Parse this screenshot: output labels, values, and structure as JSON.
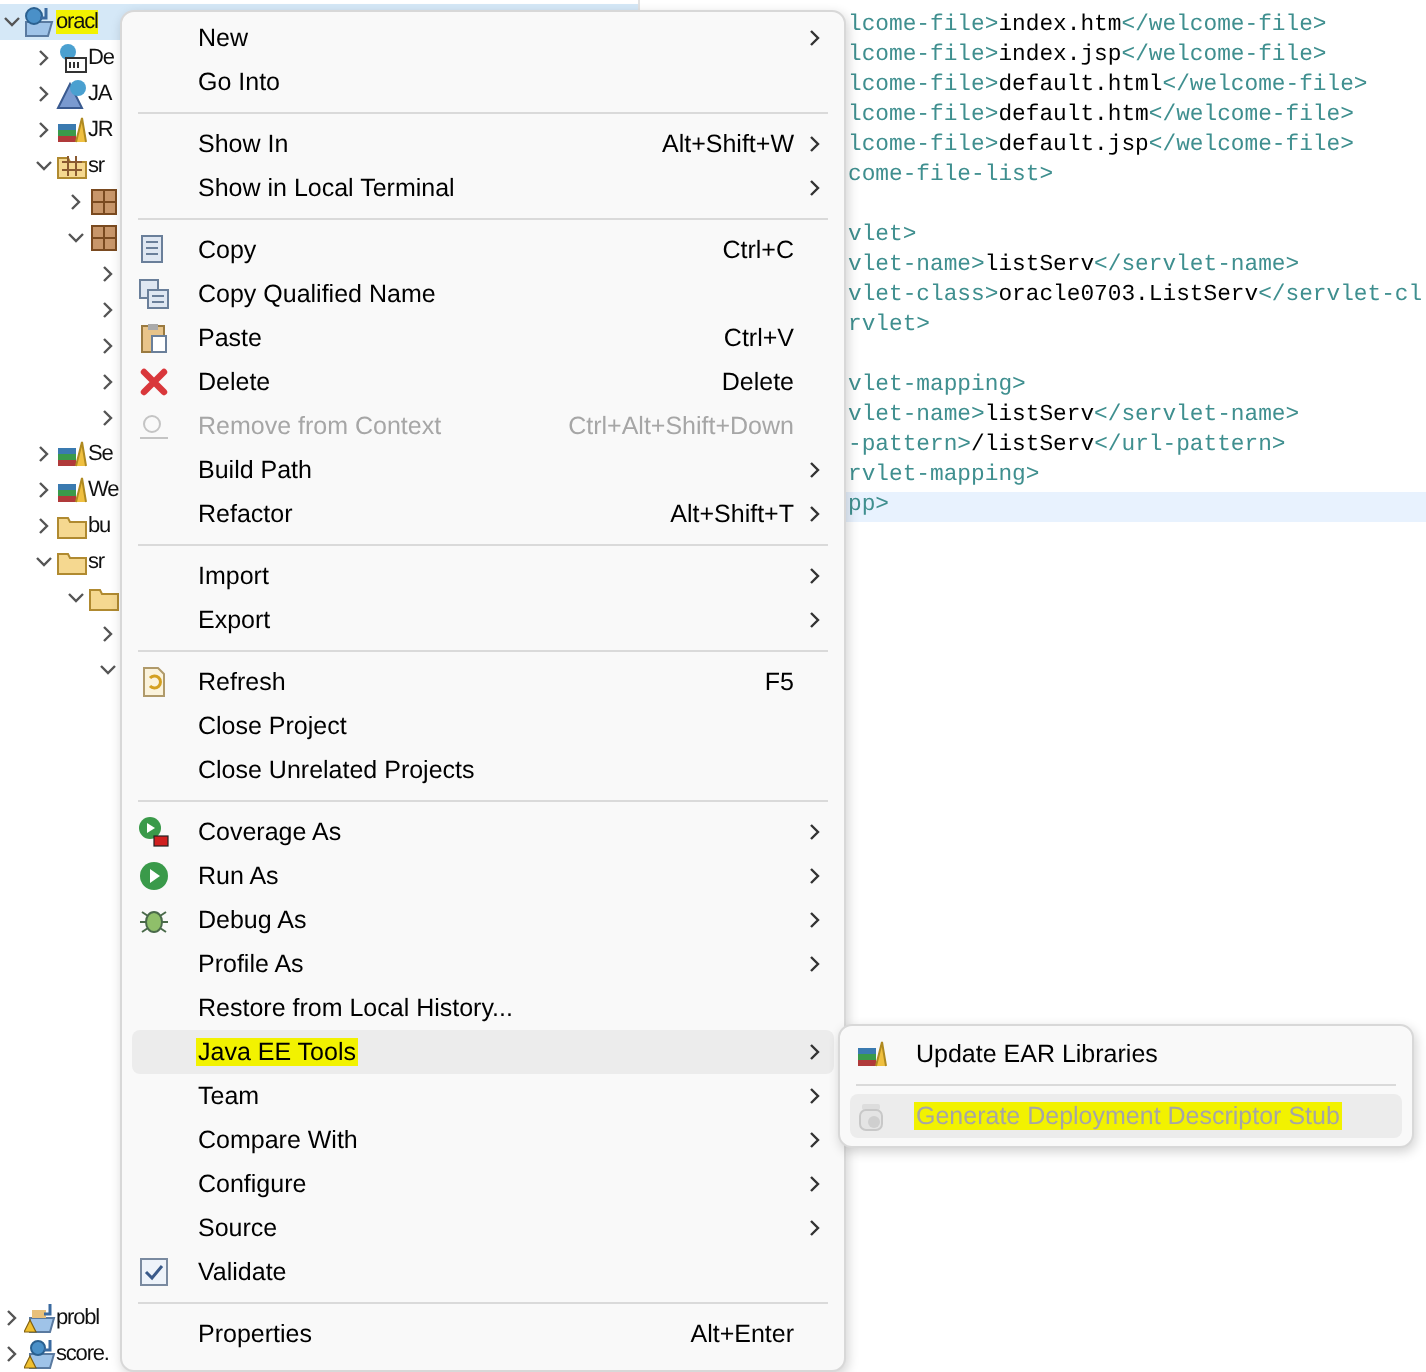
{
  "tree": [
    {
      "label": "oracl",
      "kind": "project",
      "expanded": true,
      "selected": true,
      "marked": true,
      "children": [
        {
          "label": "De",
          "kind": "descriptor",
          "expanded": false,
          "selected": false,
          "marked": false
        },
        {
          "label": "JA",
          "kind": "jax",
          "expanded": false,
          "selected": false,
          "marked": false
        },
        {
          "label": "JR",
          "kind": "library",
          "expanded": false,
          "selected": false,
          "marked": false
        },
        {
          "label": "sr",
          "kind": "package-folder",
          "expanded": true,
          "selected": false,
          "marked": false,
          "children": [
            {
              "kind": "package",
              "expanded": false,
              "selected": false
            },
            {
              "kind": "package",
              "expanded": true,
              "selected": false,
              "children": [
                {
                  "expanded": false,
                  "selected": false
                },
                {
                  "expanded": false,
                  "selected": false
                },
                {
                  "expanded": false,
                  "selected": false
                },
                {
                  "expanded": false,
                  "selected": false
                },
                {
                  "expanded": false,
                  "selected": false
                }
              ]
            }
          ]
        },
        {
          "label": "Se",
          "kind": "library",
          "expanded": false,
          "selected": false,
          "marked": false
        },
        {
          "label": "We",
          "kind": "library",
          "expanded": false,
          "selected": false,
          "marked": false
        },
        {
          "label": "bu",
          "kind": "folder",
          "expanded": false,
          "selected": false,
          "marked": false
        },
        {
          "label": "sr",
          "kind": "folder",
          "expanded": true,
          "selected": false,
          "marked": false,
          "children": [
            {
              "kind": "folder",
              "expanded": true,
              "selected": false,
              "children": [
                {
                  "expanded": false,
                  "selected": false
                },
                {
                  "expanded": true,
                  "selected": false
                }
              ]
            }
          ]
        }
      ]
    }
  ],
  "bottom_tree": [
    {
      "label": "probl",
      "kind": "warning-project",
      "expanded": false,
      "selected": false,
      "marked": false
    },
    {
      "label": "score.",
      "kind": "warning-web-project",
      "expanded": false,
      "selected": false,
      "marked": false
    }
  ],
  "editor_lines": [
    {
      "kind": "code",
      "current": false,
      "segments": [
        {
          "kind": "tag",
          "text": "lcome-file>"
        },
        {
          "kind": "text",
          "text": "index.htm"
        },
        {
          "kind": "tag",
          "text": "</welcome-file>"
        }
      ]
    },
    {
      "kind": "code",
      "current": false,
      "segments": [
        {
          "kind": "tag",
          "text": "lcome-file>"
        },
        {
          "kind": "text",
          "text": "index.jsp"
        },
        {
          "kind": "tag",
          "text": "</welcome-file>"
        }
      ]
    },
    {
      "kind": "code",
      "current": false,
      "segments": [
        {
          "kind": "tag",
          "text": "lcome-file>"
        },
        {
          "kind": "text",
          "text": "default.html"
        },
        {
          "kind": "tag",
          "text": "</welcome-file>"
        }
      ]
    },
    {
      "kind": "code",
      "current": false,
      "segments": [
        {
          "kind": "tag",
          "text": "lcome-file>"
        },
        {
          "kind": "text",
          "text": "default.htm"
        },
        {
          "kind": "tag",
          "text": "</welcome-file>"
        }
      ]
    },
    {
      "kind": "code",
      "current": false,
      "segments": [
        {
          "kind": "tag",
          "text": "lcome-file>"
        },
        {
          "kind": "text",
          "text": "default.jsp"
        },
        {
          "kind": "tag",
          "text": "</welcome-file>"
        }
      ]
    },
    {
      "kind": "code",
      "current": false,
      "segments": [
        {
          "kind": "tag",
          "text": "come-file-list>"
        }
      ]
    },
    {
      "kind": "blank",
      "current": false
    },
    {
      "kind": "code",
      "current": false,
      "segments": [
        {
          "kind": "tag",
          "text": "vlet>"
        }
      ]
    },
    {
      "kind": "code",
      "current": false,
      "segments": [
        {
          "kind": "tag",
          "text": "vlet-name>"
        },
        {
          "kind": "text",
          "text": "listServ"
        },
        {
          "kind": "tag",
          "text": "</servlet-name>"
        }
      ]
    },
    {
      "kind": "code",
      "current": false,
      "segments": [
        {
          "kind": "tag",
          "text": "vlet-class>"
        },
        {
          "kind": "text",
          "text": "oracle0703.ListServ"
        },
        {
          "kind": "tag",
          "text": "</servlet-cl"
        }
      ]
    },
    {
      "kind": "code",
      "current": false,
      "segments": [
        {
          "kind": "tag",
          "text": "rvlet>"
        }
      ]
    },
    {
      "kind": "blank",
      "current": false
    },
    {
      "kind": "code",
      "current": false,
      "segments": [
        {
          "kind": "tag",
          "text": "vlet-mapping>"
        }
      ]
    },
    {
      "kind": "code",
      "current": false,
      "segments": [
        {
          "kind": "tag",
          "text": "vlet-name>"
        },
        {
          "kind": "text",
          "text": "listServ"
        },
        {
          "kind": "tag",
          "text": "</servlet-name>"
        }
      ]
    },
    {
      "kind": "code",
      "current": false,
      "segments": [
        {
          "kind": "tag",
          "text": "-pattern>"
        },
        {
          "kind": "text",
          "text": "/listServ"
        },
        {
          "kind": "tag",
          "text": "</url-pattern>"
        }
      ]
    },
    {
      "kind": "code",
      "current": false,
      "segments": [
        {
          "kind": "tag",
          "text": "rvlet-mapping>"
        }
      ]
    },
    {
      "kind": "code",
      "current": true,
      "segments": [
        {
          "kind": "tag",
          "text": "pp>"
        }
      ]
    }
  ],
  "context_menu": {
    "sections": [
      [
        {
          "label": "New",
          "kind": "plain",
          "has_submenu": true,
          "disabled": false,
          "selected": false,
          "marked": false
        },
        {
          "label": "Go Into",
          "kind": "plain",
          "has_submenu": false,
          "disabled": false,
          "selected": false,
          "marked": false
        }
      ],
      [
        {
          "label": "Show In",
          "kind": "plain",
          "shortcut": "Alt+Shift+W",
          "has_submenu": true,
          "disabled": false,
          "selected": false,
          "marked": false
        },
        {
          "label": "Show in Local Terminal",
          "kind": "plain",
          "has_submenu": true,
          "disabled": false,
          "selected": false,
          "marked": false
        }
      ],
      [
        {
          "label": "Copy",
          "kind": "copy",
          "shortcut": "Ctrl+C",
          "has_submenu": false,
          "disabled": false,
          "selected": false,
          "marked": false
        },
        {
          "label": "Copy Qualified Name",
          "kind": "copy-qualified",
          "has_submenu": false,
          "disabled": false,
          "selected": false,
          "marked": false
        },
        {
          "label": "Paste",
          "kind": "paste",
          "shortcut": "Ctrl+V",
          "has_submenu": false,
          "disabled": false,
          "selected": false,
          "marked": false
        },
        {
          "label": "Delete",
          "kind": "delete",
          "shortcut": "Delete",
          "has_submenu": false,
          "disabled": false,
          "selected": false,
          "marked": false
        },
        {
          "label": "Remove from Context",
          "kind": "remove",
          "shortcut": "Ctrl+Alt+Shift+Down",
          "has_submenu": false,
          "disabled": true,
          "selected": false,
          "marked": false
        },
        {
          "label": "Build Path",
          "kind": "plain",
          "has_submenu": true,
          "disabled": false,
          "selected": false,
          "marked": false
        },
        {
          "label": "Refactor",
          "kind": "plain",
          "shortcut": "Alt+Shift+T",
          "has_submenu": true,
          "disabled": false,
          "selected": false,
          "marked": false
        }
      ],
      [
        {
          "label": "Import",
          "kind": "plain",
          "has_submenu": true,
          "disabled": false,
          "selected": false,
          "marked": false
        },
        {
          "label": "Export",
          "kind": "plain",
          "has_submenu": true,
          "disabled": false,
          "selected": false,
          "marked": false
        }
      ],
      [
        {
          "label": "Refresh",
          "kind": "refresh",
          "shortcut": "F5",
          "has_submenu": false,
          "disabled": false,
          "selected": false,
          "marked": false
        },
        {
          "label": "Close Project",
          "kind": "plain",
          "has_submenu": false,
          "disabled": false,
          "selected": false,
          "marked": false
        },
        {
          "label": "Close Unrelated Projects",
          "kind": "plain",
          "has_submenu": false,
          "disabled": false,
          "selected": false,
          "marked": false
        }
      ],
      [
        {
          "label": "Coverage As",
          "kind": "coverage",
          "has_submenu": true,
          "disabled": false,
          "selected": false,
          "marked": false
        },
        {
          "label": "Run As",
          "kind": "run",
          "has_submenu": true,
          "disabled": false,
          "selected": false,
          "marked": false
        },
        {
          "label": "Debug As",
          "kind": "debug",
          "has_submenu": true,
          "disabled": false,
          "selected": false,
          "marked": false
        },
        {
          "label": "Profile As",
          "kind": "plain",
          "has_submenu": true,
          "disabled": false,
          "selected": false,
          "marked": false
        },
        {
          "label": "Restore from Local History...",
          "kind": "plain",
          "has_submenu": false,
          "disabled": false,
          "selected": false,
          "marked": false
        },
        {
          "label": "Java EE Tools",
          "kind": "plain",
          "has_submenu": true,
          "disabled": false,
          "selected": true,
          "marked": true
        },
        {
          "label": "Team",
          "kind": "plain",
          "has_submenu": true,
          "disabled": false,
          "selected": false,
          "marked": false
        },
        {
          "label": "Compare With",
          "kind": "plain",
          "has_submenu": true,
          "disabled": false,
          "selected": false,
          "marked": false
        },
        {
          "label": "Configure",
          "kind": "plain",
          "has_submenu": true,
          "disabled": false,
          "selected": false,
          "marked": false
        },
        {
          "label": "Source",
          "kind": "plain",
          "has_submenu": true,
          "disabled": false,
          "selected": false,
          "marked": false
        },
        {
          "label": "Validate",
          "kind": "checkbox",
          "has_submenu": false,
          "disabled": false,
          "selected": false,
          "marked": false
        }
      ],
      [
        {
          "label": "Properties",
          "kind": "plain",
          "shortcut": "Alt+Enter",
          "has_submenu": false,
          "disabled": false,
          "selected": false,
          "marked": false
        }
      ]
    ]
  },
  "submenu": {
    "sections": [
      [
        {
          "label": "Update EAR Libraries",
          "kind": "library",
          "disabled": false,
          "selected": false,
          "marked": false
        }
      ],
      [
        {
          "label": "Generate Deployment Descriptor Stub",
          "kind": "jar",
          "disabled": true,
          "selected": true,
          "marked": true
        }
      ]
    ]
  }
}
